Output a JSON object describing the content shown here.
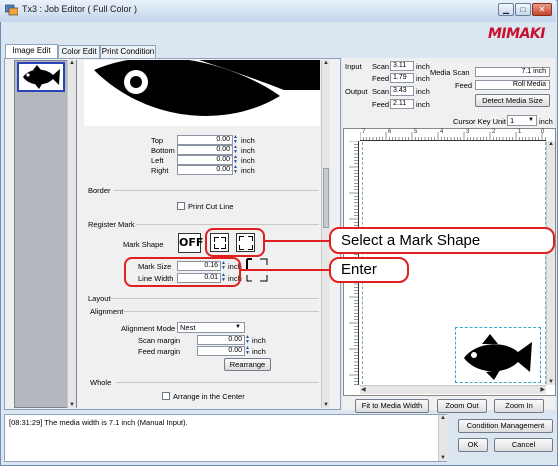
{
  "window": {
    "title": "Tx3 : Job Editor ( Full Color )",
    "logo_text": "Mimaki",
    "logo_color": "#c8102e",
    "controls": [
      "minimize-icon",
      "maximize-icon",
      "close-icon"
    ]
  },
  "tabs": [
    {
      "label": "Image Edit",
      "active": true
    },
    {
      "label": "Color Edit",
      "active": false
    },
    {
      "label": "Print Condition",
      "active": false
    }
  ],
  "margins": {
    "top_label": "Top",
    "top_value": "0.00",
    "bottom_label": "Bottom",
    "bottom_value": "0.00",
    "left_label": "Left",
    "left_value": "0.00",
    "right_label": "Right",
    "right_value": "0.00",
    "unit": "inch"
  },
  "border": {
    "section_label": "Border",
    "print_cut_line_label": "Print Cut Line"
  },
  "register_mark": {
    "section_label": "Register Mark",
    "mark_shape_label": "Mark Shape",
    "mark_shape_off": "OFF",
    "mark_size_label": "Mark Size",
    "mark_size_value": "0.16",
    "line_width_label": "Line Width",
    "line_width_value": "0.01",
    "unit": "inch"
  },
  "layout": {
    "section_label": "Layout",
    "alignment_label": "Alignment",
    "alignment_mode_label": "Alignment Mode",
    "alignment_mode_value": "Nest",
    "scan_margin_label": "Scan margin",
    "scan_margin_value": "0.00",
    "feed_margin_label": "Feed margin",
    "feed_margin_value": "0.00",
    "unit": "inch",
    "rearrange_label": "Rearrange",
    "whole_label": "Whole",
    "arrange_center_label": "Arrange in the Center"
  },
  "info": {
    "input_label": "Input",
    "scan_label": "Scan",
    "feed_label": "Feed",
    "output_label": "Output",
    "input_scan": "3.11",
    "input_feed": "1.79",
    "output_scan": "3.43",
    "output_feed": "2.11",
    "unit": "inch",
    "media_scan_label": "Media Scan",
    "media_scan_value": "7.1 inch",
    "media_feed_label": "Feed",
    "media_feed_value": "Roll Media",
    "detect_media_label": "Detect Media Size",
    "cursor_key_label": "Cursor Key Unit",
    "cursor_key_value": "1",
    "cursor_key_unit": "inch"
  },
  "ruler": {
    "top_numbers": [
      "7",
      "6",
      "5",
      "4",
      "3",
      "2",
      "1",
      "0"
    ]
  },
  "canvas_buttons": {
    "fit_label": "Fit to Media Width",
    "zoom_out_label": "Zoom Out",
    "zoom_in_label": "Zoom In"
  },
  "log": {
    "message": "[08:31:29] The media width is 7.1 inch (Manual Input)."
  },
  "bottom_buttons": {
    "condition_label": "Condition Management",
    "ok_label": "OK",
    "cancel_label": "Cancel"
  },
  "callouts": {
    "select_mark_shape": "Select a Mark Shape",
    "enter": "Enter",
    "color": "#e02020"
  }
}
